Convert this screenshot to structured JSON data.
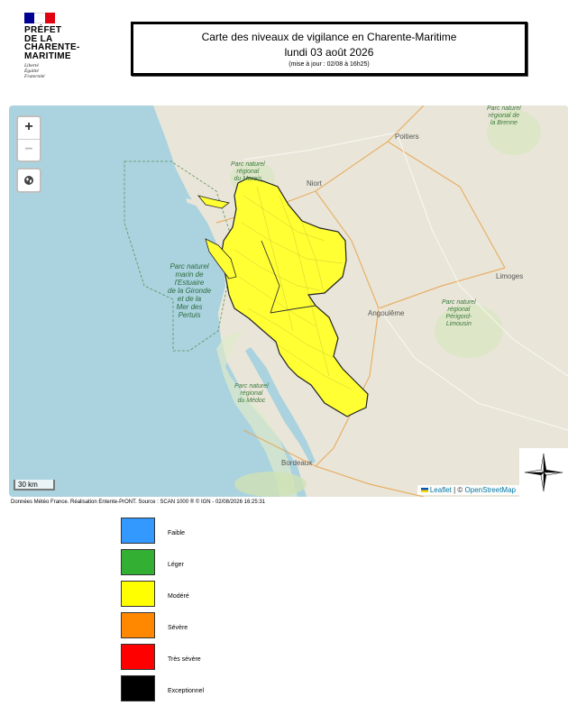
{
  "header": {
    "logo_title": "PRÉFET\nDE LA\nCHARENTE-\nMARITIME",
    "logo_motto": "Liberté\nÉgalité\nFraternité"
  },
  "title": {
    "line1": "Carte des niveaux de vigilance en Charente-Maritime",
    "date": "lundi 03 août 2026",
    "update": "(mise à jour : 02/08 à 16h25)"
  },
  "map": {
    "zoom_in": "+",
    "zoom_out": "−",
    "scale": "30 km",
    "attribution_link": "Leaflet",
    "attribution_sep": " | © ",
    "attribution_osm": "OpenStreetMap",
    "vigilance_color": "#ffff33",
    "places": {
      "poitiers": "Poitiers",
      "niort": "Niort",
      "limoges": "Limoges",
      "angouleme": "Angoulême",
      "bordeaux": "Bordeaux"
    },
    "parks": {
      "marais": "Parc naturel\nrégional\ndu Marais",
      "brenne": "Parc naturel\nrégional de\nla Brenne",
      "perigord": "Parc naturel\nrégional\nPérigord-\nLimousin",
      "medoc": "Parc naturel\nrégional\ndu Médoc",
      "marin": "Parc naturel\nmarin de\nl'Estuaire\nde la Gironde\net de la\nMer des\nPertuis"
    }
  },
  "source": "Données Météo France. Réalisation Entente-PrONT. Source : SCAN 1000 ® © IGN - 02/08/2026 16:25:31",
  "legend": [
    {
      "label": "Faible",
      "color": "#3399ff"
    },
    {
      "label": "Léger",
      "color": "#33b033"
    },
    {
      "label": "Modéré",
      "color": "#ffff00"
    },
    {
      "label": "Sévère",
      "color": "#ff8800"
    },
    {
      "label": "Très sévère",
      "color": "#ff0000"
    },
    {
      "label": "Exceptionnel",
      "color": "#000000"
    }
  ]
}
